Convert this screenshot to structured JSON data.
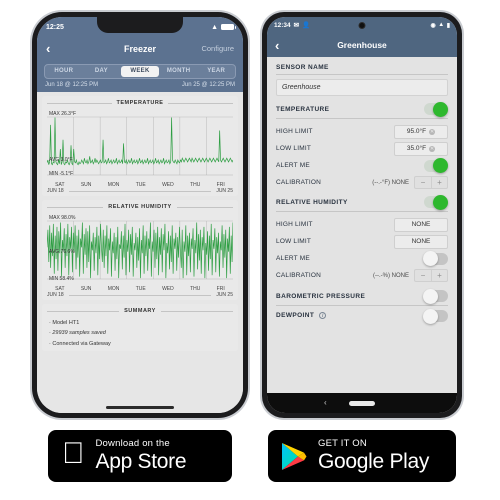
{
  "ios": {
    "status": {
      "time": "12:25",
      "wifi_icon": "wifi-icon",
      "battery_icon": "battery-icon"
    },
    "nav": {
      "back_icon": "chevron-left-icon",
      "title": "Freezer",
      "action_label": "Configure"
    },
    "segments": [
      {
        "label": "HOUR",
        "active": false
      },
      {
        "label": "DAY",
        "active": false
      },
      {
        "label": "WEEK",
        "active": true
      },
      {
        "label": "MONTH",
        "active": false
      },
      {
        "label": "YEAR",
        "active": false
      }
    ],
    "date_range": {
      "start": "Jun 18 @ 12:25 PM",
      "end": "Jun 25 @ 12:25 PM"
    },
    "temperature_card": {
      "title": "TEMPERATURE",
      "max_label": "MAX 26.3°F",
      "avg_label": "AVG 3.0°F",
      "min_label": "MIN -5.1°F",
      "day_labels": [
        "SAT",
        "SUN",
        "MON",
        "TUE",
        "WED",
        "THU",
        "FRI"
      ],
      "start_date": "JUN 18",
      "end_date": "JUN 25"
    },
    "humidity_card": {
      "title": "RELATIVE HUMIDITY",
      "max_label": "MAX 98.0%",
      "avg_label": "AVG 76.6%",
      "min_label": "MIN 58.4%",
      "day_labels": [
        "SAT",
        "SUN",
        "MON",
        "TUE",
        "WED",
        "THU",
        "FRI"
      ],
      "start_date": "JUN 18",
      "end_date": "JUN 25"
    },
    "summary_card": {
      "title": "SUMMARY",
      "lines": [
        "· Model HT1",
        "· 29939 samples saved",
        "· Connected via Gateway"
      ]
    }
  },
  "android": {
    "status": {
      "time": "12:34",
      "left_icons": [
        "message-icon",
        "person-icon"
      ],
      "right_icons": [
        "eye-icon",
        "wifi-icon",
        "battery-icon"
      ]
    },
    "nav": {
      "back_icon": "chevron-left-icon",
      "title": "Greenhouse"
    },
    "sensor_name": {
      "label": "SENSOR NAME",
      "value": "Greenhouse",
      "placeholder": "Sensor name"
    },
    "sections": [
      {
        "title": "TEMPERATURE",
        "enabled": true,
        "rows": [
          {
            "label": "HIGH LIMIT",
            "type": "value",
            "value": "95.0°F",
            "clearable": true
          },
          {
            "label": "LOW LIMIT",
            "type": "value",
            "value": "35.0°F",
            "clearable": true
          },
          {
            "label": "ALERT ME",
            "type": "toggle",
            "on": true
          },
          {
            "label": "CALIBRATION",
            "type": "calibration",
            "value": "(--.-°F) NONE",
            "minus": "−",
            "plus": "+"
          }
        ]
      },
      {
        "title": "RELATIVE HUMIDITY",
        "enabled": true,
        "rows": [
          {
            "label": "HIGH LIMIT",
            "type": "value",
            "value": "NONE",
            "clearable": false
          },
          {
            "label": "LOW LIMIT",
            "type": "value",
            "value": "NONE",
            "clearable": false
          },
          {
            "label": "ALERT ME",
            "type": "toggle",
            "on": false
          },
          {
            "label": "CALIBRATION",
            "type": "calibration",
            "value": "(--.-%) NONE",
            "minus": "−",
            "plus": "+"
          }
        ]
      },
      {
        "title": "BAROMETRIC PRESSURE",
        "enabled": false,
        "rows": []
      },
      {
        "title": "DEWPOINT",
        "enabled": false,
        "info_icon": "info-icon",
        "rows": []
      }
    ],
    "navbar": {
      "back_icon": "chevron-left-icon",
      "home_pill": "home-pill"
    }
  },
  "badges": {
    "ios": {
      "small": "Download on the",
      "large": "App Store",
      "icon": "apple-logo-icon"
    },
    "android": {
      "small": "GET IT ON",
      "large": "Google Play",
      "icon": "google-play-icon"
    }
  },
  "colors": {
    "nav_blue": "#5c7290",
    "chart_green": "#2e9e43",
    "toggle_on": "#2eb82e",
    "badge_black": "#000000"
  },
  "chart_data": [
    {
      "type": "line",
      "title": "TEMPERATURE",
      "ylabel": "°F",
      "xlabel": "",
      "categories": [
        "SAT",
        "SUN",
        "MON",
        "TUE",
        "WED",
        "THU",
        "FRI"
      ],
      "ylim": [
        -5.1,
        26.3
      ],
      "max": 26.3,
      "avg": 3.0,
      "min": -5.1,
      "grid": true,
      "legend": "none",
      "values": [
        1.5,
        3,
        0.5,
        2,
        22,
        1,
        0.5,
        2,
        1.5,
        26,
        2,
        1,
        0.5,
        3,
        1,
        9,
        0.5,
        2,
        14,
        1,
        0.5,
        2,
        1.5,
        3,
        1,
        0.5,
        2,
        11,
        1,
        0.5,
        9,
        2,
        1.5,
        3,
        1,
        0.5,
        2,
        1,
        1.5,
        3,
        2,
        1,
        4,
        2,
        1.5,
        3,
        1,
        2,
        5,
        1.5,
        2,
        3,
        1,
        2,
        4,
        1.5,
        3,
        2,
        1,
        2,
        3,
        1.5,
        2,
        14,
        1.5,
        2,
        3,
        1,
        2,
        4,
        1.5,
        2,
        3,
        1,
        2,
        3,
        1.5,
        2,
        4,
        1,
        2,
        3,
        1.5,
        2,
        3,
        1,
        12,
        2,
        1.5,
        3,
        1,
        2,
        3,
        1.5,
        2,
        4,
        1,
        2,
        3,
        1.5,
        2,
        3,
        1,
        2,
        4,
        1.5,
        2,
        3,
        1,
        2,
        3,
        1.5,
        2,
        4,
        1,
        2,
        3,
        1.5,
        2,
        3,
        1,
        2,
        4,
        1.5,
        2,
        3,
        1,
        2,
        3,
        1.5,
        2,
        4,
        1,
        2,
        3,
        1.5,
        2,
        3,
        1,
        2,
        26,
        3,
        2,
        1.5,
        3,
        2,
        1,
        3,
        2,
        1.5,
        3,
        2,
        4,
        3,
        2,
        3,
        4,
        3,
        2,
        3,
        4,
        3,
        2,
        4,
        3,
        2,
        3,
        4,
        3,
        2,
        3,
        4,
        3,
        2,
        3,
        4,
        3,
        2,
        3,
        4,
        3,
        2,
        3,
        4,
        3,
        2,
        3,
        4,
        3,
        2,
        3,
        4,
        3,
        2,
        19,
        3,
        2,
        3,
        4,
        3,
        2,
        3,
        4,
        3,
        2,
        3,
        4,
        3,
        2,
        3
      ]
    },
    {
      "type": "line",
      "title": "RELATIVE HUMIDITY",
      "ylabel": "%",
      "xlabel": "",
      "categories": [
        "SAT",
        "SUN",
        "MON",
        "TUE",
        "WED",
        "THU",
        "FRI"
      ],
      "ylim": [
        58.4,
        98.0
      ],
      "max": 98.0,
      "avg": 76.6,
      "min": 58.4,
      "grid": true,
      "legend": "none",
      "values": [
        80,
        92,
        70,
        95,
        66,
        90,
        74,
        96,
        62,
        88,
        72,
        94,
        64,
        91,
        76,
        97,
        60,
        85,
        78,
        93,
        66,
        89,
        74,
        96,
        61,
        87,
        79,
        94,
        63,
        90,
        77,
        95,
        65,
        88,
        73,
        92,
        60,
        86,
        80,
        97,
        62,
        89,
        75,
        93,
        66,
        91,
        70,
        95,
        59,
        84,
        78,
        90,
        64,
        87,
        76,
        94,
        61,
        88,
        72,
        96,
        80,
        70,
        92,
        66,
        88,
        74,
        95,
        62,
        86,
        78,
        93,
        60,
        84,
        76,
        90,
        64,
        87,
        72,
        94,
        59,
        82,
        79,
        91,
        65,
        88,
        73,
        96,
        61,
        85,
        77,
        92,
        63,
        89,
        75,
        94,
        60,
        83,
        78,
        90,
        66,
        87,
        71,
        93,
        59,
        85,
        76,
        95,
        62,
        88,
        74,
        91,
        64,
        86,
        79,
        97,
        60,
        84,
        77,
        92,
        66,
        90,
        72,
        94,
        61,
        87,
        75,
        93,
        63,
        89,
        78,
        96,
        59,
        83,
        76,
        91,
        65,
        88,
        70,
        95,
        62,
        86,
        79,
        90,
        64,
        87,
        73,
        94,
        78,
        66,
        92,
        59,
        84,
        77,
        95,
        61,
        88,
        74,
        90,
        63,
        86,
        79,
        93,
        60,
        85,
        76,
        97,
        65,
        89,
        71,
        92,
        62,
        87,
        78,
        94,
        59,
        83,
        75,
        91,
        64,
        88,
        72,
        96,
        61,
        85,
        79,
        93,
        63,
        87,
        76,
        90,
        60,
        84,
        78,
        95,
        66,
        89,
        73,
        92,
        59,
        86,
        77,
        94,
        62,
        88,
        70,
        97
      ]
    }
  ]
}
